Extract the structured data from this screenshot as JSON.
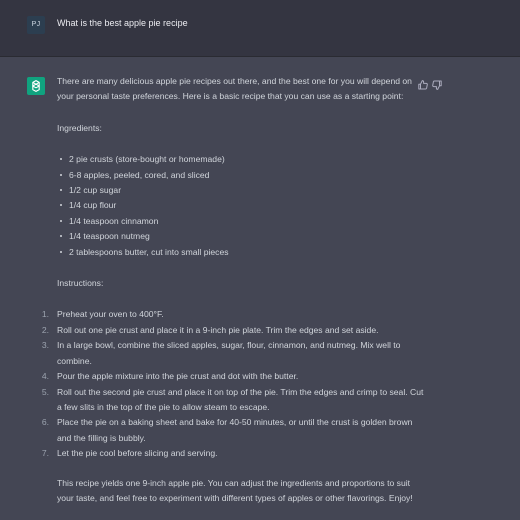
{
  "user": {
    "avatar_initials": "PJ",
    "message": "What is the best apple pie recipe"
  },
  "assistant": {
    "intro": "There are many delicious apple pie recipes out there, and the best one for you will depend on your personal taste preferences. Here is a basic recipe that you can use as a starting point:",
    "ingredients_heading": "Ingredients:",
    "ingredients": [
      "2 pie crusts (store-bought or homemade)",
      "6-8 apples, peeled, cored, and sliced",
      "1/2 cup sugar",
      "1/4 cup flour",
      "1/4 teaspoon cinnamon",
      "1/4 teaspoon nutmeg",
      "2 tablespoons butter, cut into small pieces"
    ],
    "instructions_heading": "Instructions:",
    "instructions": [
      {
        "num": "1.",
        "text": "Preheat your oven to 400°F."
      },
      {
        "num": "2.",
        "text": "Roll out one pie crust and place it in a 9-inch pie plate. Trim the edges and set aside."
      },
      {
        "num": "3.",
        "text": "In a large bowl, combine the sliced apples, sugar, flour, cinnamon, and nutmeg. Mix well to combine."
      },
      {
        "num": "4.",
        "text": "Pour the apple mixture into the pie crust and dot with the butter."
      },
      {
        "num": "5.",
        "text": "Roll out the second pie crust and place it on top of the pie. Trim the edges and crimp to seal. Cut a few slits in the top of the pie to allow steam to escape."
      },
      {
        "num": "6.",
        "text": "Place the pie on a baking sheet and bake for 40-50 minutes, or until the crust is golden brown and the filling is bubbly."
      },
      {
        "num": "7.",
        "text": "Let the pie cool before slicing and serving."
      }
    ],
    "closing": "This recipe yields one 9-inch apple pie. You can adjust the ingredients and proportions to suit your taste, and feel free to experiment with different types of apples or other flavorings. Enjoy!"
  },
  "icons": {
    "assistant_avatar": "openai-logo-icon",
    "thumbs_up": "thumbs-up-icon",
    "thumbs_down": "thumbs-down-icon"
  },
  "colors": {
    "user_bg": "#343541",
    "assistant_bg": "#444654",
    "assistant_avatar_bg": "#10a37f",
    "user_avatar_bg": "#2c3e50"
  }
}
